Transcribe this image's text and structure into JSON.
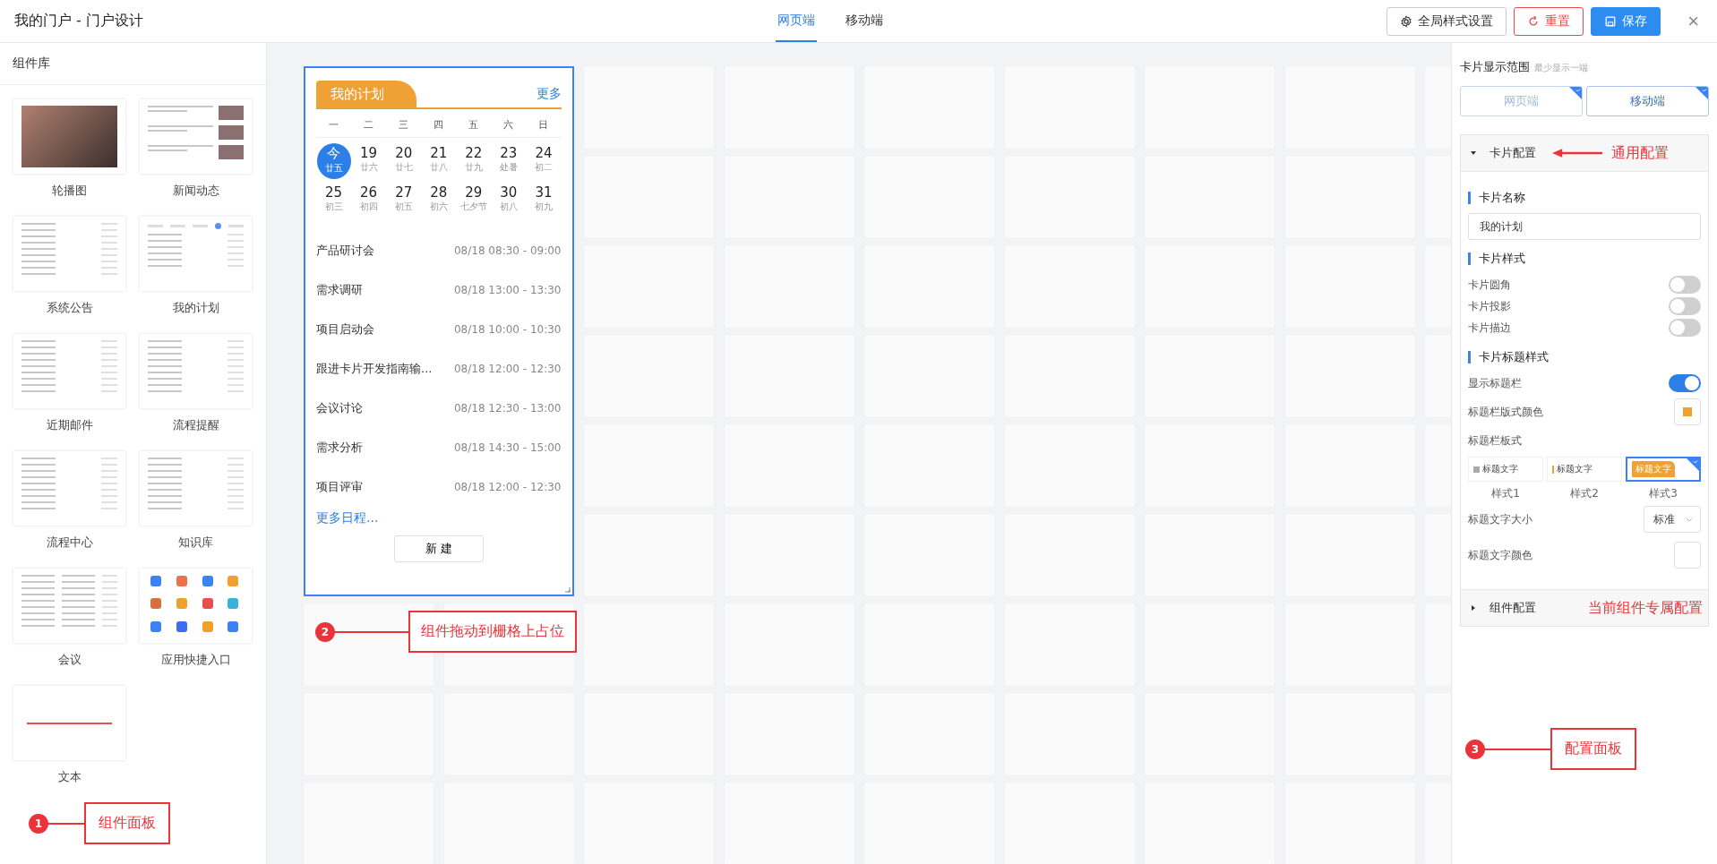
{
  "window": {
    "title": "我的门户 - 门户设计",
    "close": "×"
  },
  "tabs": [
    {
      "label": "网页端",
      "selected": true
    },
    {
      "label": "移动端",
      "selected": false
    }
  ],
  "toolbar": [
    {
      "kind": "settings",
      "label": "全局样式设置"
    },
    {
      "kind": "reset",
      "label": "重置"
    },
    {
      "kind": "save",
      "label": "保存"
    }
  ],
  "component_library": {
    "title": "组件库",
    "items": [
      {
        "label": "轮播图",
        "kind": "photo"
      },
      {
        "label": "新闻动态",
        "kind": "news"
      },
      {
        "label": "系统公告",
        "kind": "list"
      },
      {
        "label": "我的计划",
        "kind": "calendar"
      },
      {
        "label": "近期邮件",
        "kind": "list"
      },
      {
        "label": "流程提醒",
        "kind": "list"
      },
      {
        "label": "流程中心",
        "kind": "list"
      },
      {
        "label": "知识库",
        "kind": "list"
      },
      {
        "label": "会议",
        "kind": "table"
      },
      {
        "label": "应用快捷入口",
        "kind": "apps"
      },
      {
        "label": "文本",
        "kind": "text"
      }
    ]
  },
  "card": {
    "title": "我的计划",
    "more": "更多",
    "weekdays": [
      "一",
      "二",
      "三",
      "四",
      "五",
      "六",
      "日"
    ],
    "days": [
      {
        "day": "今",
        "lunar": "廿五",
        "selected": true
      },
      {
        "day": "19",
        "lunar": "廿六",
        "selected": false
      },
      {
        "day": "20",
        "lunar": "廿七",
        "selected": false
      },
      {
        "day": "21",
        "lunar": "廿八",
        "selected": false
      },
      {
        "day": "22",
        "lunar": "廿九",
        "selected": false
      },
      {
        "day": "23",
        "lunar": "处暑",
        "selected": false
      },
      {
        "day": "24",
        "lunar": "初二",
        "selected": false
      },
      {
        "day": "25",
        "lunar": "初三",
        "selected": false
      },
      {
        "day": "26",
        "lunar": "初四",
        "selected": false
      },
      {
        "day": "27",
        "lunar": "初五",
        "selected": false
      },
      {
        "day": "28",
        "lunar": "初六",
        "selected": false
      },
      {
        "day": "29",
        "lunar": "七夕节",
        "selected": false
      },
      {
        "day": "30",
        "lunar": "初八",
        "selected": false
      },
      {
        "day": "31",
        "lunar": "初九",
        "selected": false
      }
    ],
    "events": [
      {
        "name": "产品研讨会",
        "time": "08/18 08:30 - 09:00"
      },
      {
        "name": "需求调研",
        "time": "08/18 13:00 - 13:30"
      },
      {
        "name": "项目启动会",
        "time": "08/18 10:00 - 10:30"
      },
      {
        "name": "跟进卡片开发指南输...",
        "time": "08/18 12:00 - 12:30"
      },
      {
        "name": "会议讨论",
        "time": "08/18 12:30 - 13:00"
      },
      {
        "name": "需求分析",
        "time": "08/18 14:30 - 15:00"
      },
      {
        "name": "项目评审",
        "time": "08/18 12:00 - 12:30"
      }
    ],
    "more_link": "更多日程...",
    "button": "新 建"
  },
  "config_panel": {
    "range_title": "卡片显示范围",
    "range_hint": "最少显示一端",
    "range_options": [
      {
        "label": "网页端",
        "checked": true,
        "disabled": true
      },
      {
        "label": "移动端",
        "checked": true,
        "disabled": false
      }
    ],
    "card_config": {
      "title": "卡片配置",
      "expanded": true,
      "note": "通用配置",
      "groups": [
        {
          "heading": "卡片名称",
          "fields": [
            {
              "kind": "input",
              "value": "我的计划"
            }
          ]
        },
        {
          "heading": "卡片样式",
          "fields": [
            {
              "kind": "toggle",
              "label": "卡片圆角",
              "on": false
            },
            {
              "kind": "toggle",
              "label": "卡片投影",
              "on": false
            },
            {
              "kind": "toggle",
              "label": "卡片描边",
              "on": false
            }
          ]
        },
        {
          "heading": "卡片标题样式",
          "fields": [
            {
              "kind": "toggle",
              "label": "显示标题栏",
              "on": true
            },
            {
              "kind": "color",
              "label": "标题栏版式颜色",
              "color": "#f0a02c"
            },
            {
              "kind": "styles",
              "label": "标题栏板式",
              "options": [
                {
                  "sample": "标题文字",
                  "label": "样式1",
                  "selected": false
                },
                {
                  "sample": "标题文字",
                  "label": "样式2",
                  "selected": false
                },
                {
                  "sample": "标题文字",
                  "label": "样式3",
                  "selected": true
                }
              ]
            },
            {
              "kind": "select",
              "label": "标题文字大小",
              "value": "标准"
            },
            {
              "kind": "color",
              "label": "标题文字颜色",
              "color": "#ffffff"
            }
          ]
        }
      ]
    },
    "component_config": {
      "title": "组件配置",
      "expanded": false,
      "note": "当前组件专属配置"
    }
  },
  "annotations": [
    {
      "number": "1",
      "label": "组件面板"
    },
    {
      "number": "2",
      "label": "组件拖动到栅格上占位"
    },
    {
      "number": "3",
      "label": "配置面板"
    }
  ]
}
